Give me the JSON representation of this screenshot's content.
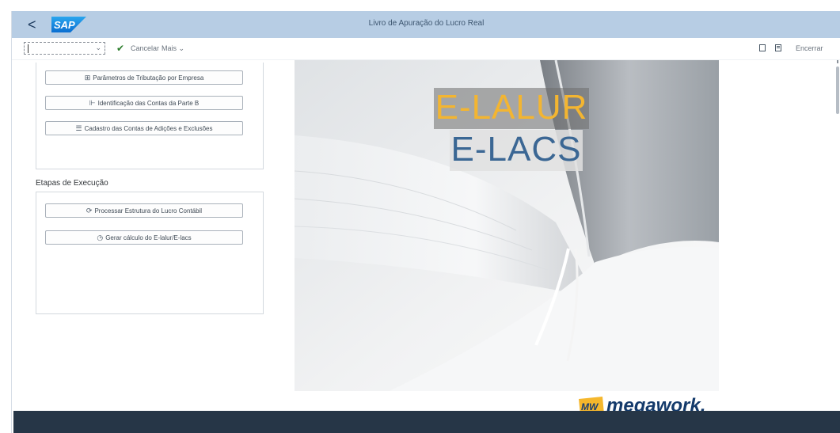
{
  "shell": {
    "title": "Livro de Apuração do Lucro Real",
    "logo_text": "SAP",
    "back_label": "<"
  },
  "toolbar": {
    "cancel_label": "Cancelar",
    "more_label": "Mais",
    "more_chevron": "⌄",
    "exit_label": "Encerrar"
  },
  "config_buttons": [
    {
      "label": "Parâmetros de Tributação por Empresa",
      "icon": "grid-icon",
      "glyph": "⊞"
    },
    {
      "label": "Identificação das Contas da Parte B",
      "icon": "tree-icon",
      "glyph": "⊩"
    },
    {
      "label": "Cadastro das Contas de Adições e Exclusões",
      "icon": "list-icon",
      "glyph": "☰"
    }
  ],
  "execution": {
    "title": "Etapas de Execução",
    "buttons": [
      {
        "label": "Processar Estrutura do Lucro Contábil",
        "icon": "process-icon",
        "glyph": "⟳"
      },
      {
        "label": "Gerar cálculo do E-lalur/E-lacs",
        "icon": "calculate-icon",
        "glyph": "◷"
      }
    ]
  },
  "banner": {
    "line1": "E-LALUR",
    "line2": "E-LACS",
    "line1_color": "#f3b531",
    "line2_color": "#3b6794",
    "brand": "megawork.",
    "brand_mark": "MW",
    "brand_color": "#143a6b"
  },
  "colors": {
    "shellbar": "#b7cde4",
    "footer": "#263647"
  }
}
